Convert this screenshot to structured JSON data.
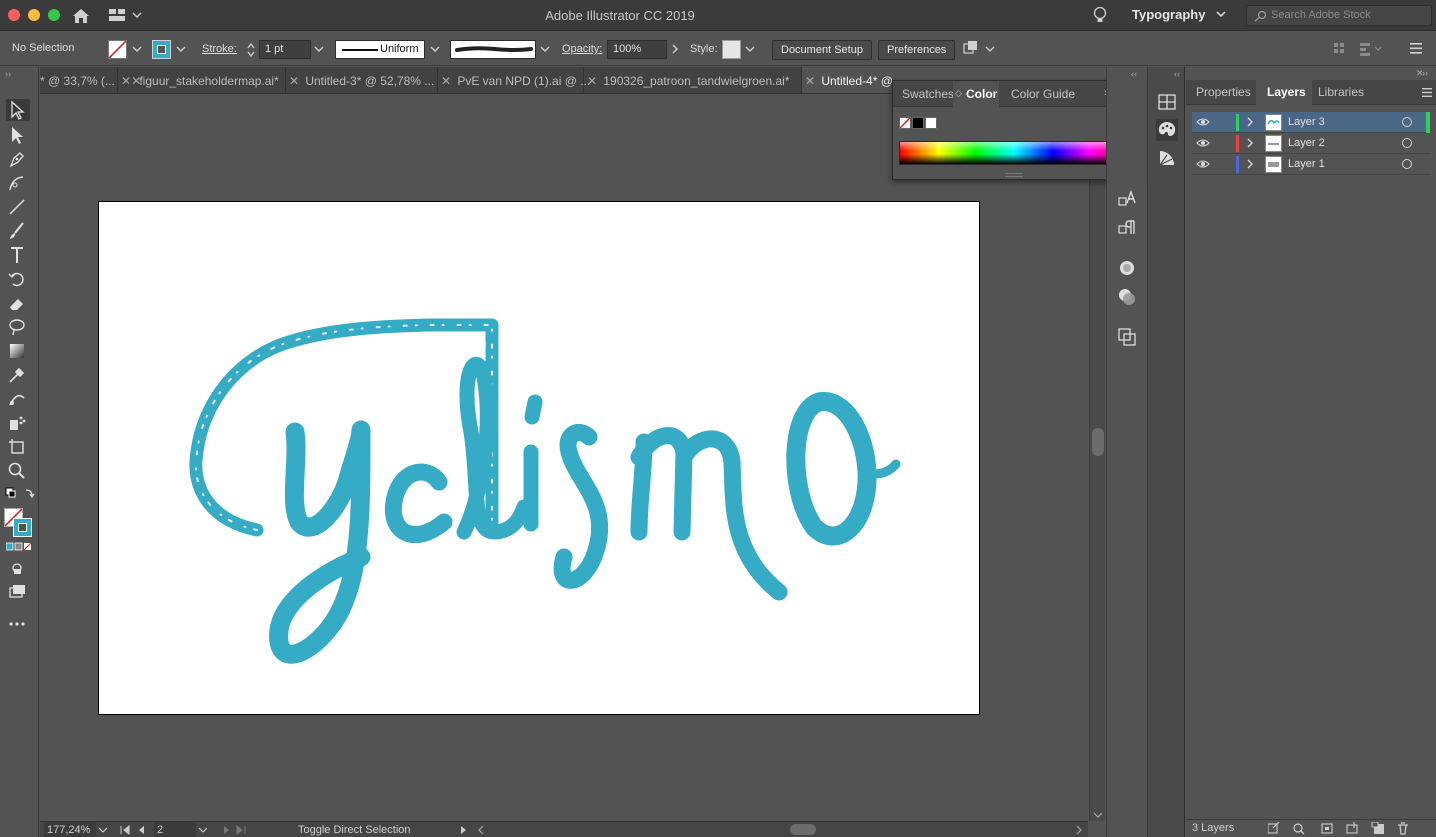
{
  "titlebar": {
    "app_title": "Adobe Illustrator CC 2019",
    "workspace": "Typography",
    "stock_search_placeholder": "Search Adobe Stock"
  },
  "controlbar": {
    "selection": "No Selection",
    "stroke_label": "Stroke:",
    "stroke_weight": "1 pt",
    "stroke_profile": "Uniform",
    "opacity_label": "Opacity:",
    "opacity_value": "100%",
    "style_label": "Style:",
    "document_setup": "Document Setup",
    "preferences": "Preferences"
  },
  "tabs": [
    {
      "label": "* @ 33,7% (..."
    },
    {
      "label": "figuur_stakeholdermap.ai*"
    },
    {
      "label": "Untitled-3* @ 52,78% ..."
    },
    {
      "label": "PvE van NPD (1).ai @ ..."
    },
    {
      "label": "190326_patroon_tandwielgroen.ai*"
    },
    {
      "label": "Untitled-4* @"
    }
  ],
  "colorpanel": {
    "tabs": [
      "Swatches",
      "Color",
      "Color Guide"
    ],
    "active_tab": "Color"
  },
  "rightpanel": {
    "tabs": [
      "Properties",
      "Layers",
      "Libraries"
    ],
    "active_tab": "Layers",
    "layers": [
      {
        "name": "Layer 3",
        "color": "#2fd15c",
        "selected": true
      },
      {
        "name": "Layer 2",
        "color": "#e8403c",
        "selected": false
      },
      {
        "name": "Layer 1",
        "color": "#4a68e0",
        "selected": false
      }
    ],
    "layer_count": "3 Layers"
  },
  "statusbar": {
    "zoom": "177,24%",
    "page": "2",
    "status_text": "Toggle Direct Selection"
  },
  "artwork": {
    "text": "yclismo",
    "color": "#35abc6"
  }
}
